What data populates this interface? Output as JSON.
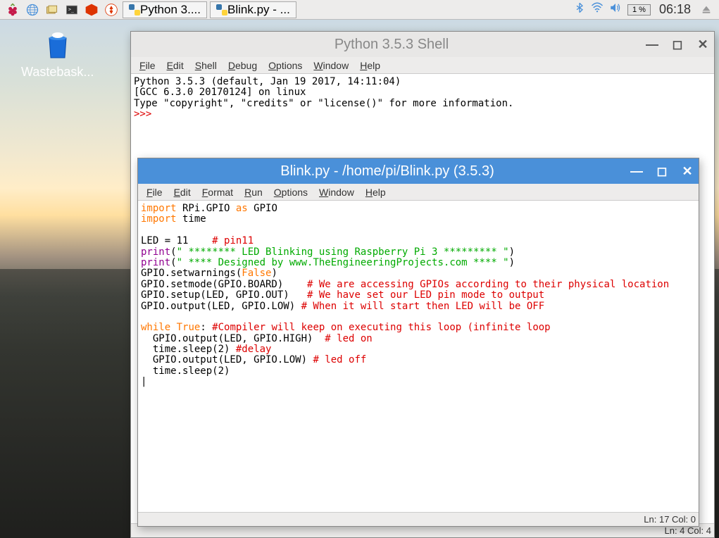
{
  "taskbar": {
    "apps": [
      {
        "label": "Python 3...."
      },
      {
        "label": "Blink.py - ..."
      }
    ],
    "battery": "1 %",
    "clock": "06:18"
  },
  "desktop": {
    "wastebasket_label": "Wastebask..."
  },
  "shell_window": {
    "title": "Python 3.5.3 Shell",
    "menu": [
      "File",
      "Edit",
      "Shell",
      "Debug",
      "Options",
      "Window",
      "Help"
    ],
    "lines": {
      "l1": "Python 3.5.3 (default, Jan 19 2017, 14:11:04)",
      "l2": "[GCC 6.3.0 20170124] on linux",
      "l3": "Type \"copyright\", \"credits\" or \"license()\" for more information.",
      "prompt": ">>> "
    },
    "status": "Ln: 4  Col: 4"
  },
  "editor_window": {
    "title": "Blink.py - /home/pi/Blink.py (3.5.3)",
    "menu": [
      "File",
      "Edit",
      "Format",
      "Run",
      "Options",
      "Window",
      "Help"
    ],
    "code": {
      "l1_import": "import",
      "l1_rest": " RPi.GPIO ",
      "l1_as": "as",
      "l1_gpio": " GPIO",
      "l2_import": "import",
      "l2_rest": " time",
      "l3": "",
      "l4_a": "LED = 11    ",
      "l4_c": "# pin11",
      "l5_print": "print",
      "l5_p1": "(",
      "l5_str": "\" ******** LED Blinking using Raspberry Pi 3 ********* \"",
      "l5_p2": ")",
      "l6_print": "print",
      "l6_p1": "(",
      "l6_str": "\" **** Designed by www.TheEngineeringProjects.com **** \"",
      "l6_p2": ")",
      "l7_a": "GPIO.setwarnings(",
      "l7_false": "False",
      "l7_b": ")",
      "l8_a": "GPIO.setmode(GPIO.BOARD)    ",
      "l8_c": "# We are accessing GPIOs according to their physical location",
      "l9_a": "GPIO.setup(LED, GPIO.OUT)   ",
      "l9_c": "# We have set our LED pin mode to output",
      "l10_a": "GPIO.output(LED, GPIO.LOW) ",
      "l10_c": "# When it will start then LED will be OFF",
      "l11": "",
      "l12_while": "while",
      "l12_sp": " ",
      "l12_true": "True",
      "l12_colon": ": ",
      "l12_c": "#Compiler will keep on executing this loop (infinite loop",
      "l13_a": "  GPIO.output(LED, GPIO.HIGH)  ",
      "l13_c": "# led on",
      "l14_a": "  time.sleep(2) ",
      "l14_c": "#delay",
      "l15_a": "  GPIO.output(LED, GPIO.LOW) ",
      "l15_c": "# led off",
      "l16": "  time.sleep(2)"
    },
    "status": "Ln: 17  Col: 0"
  }
}
